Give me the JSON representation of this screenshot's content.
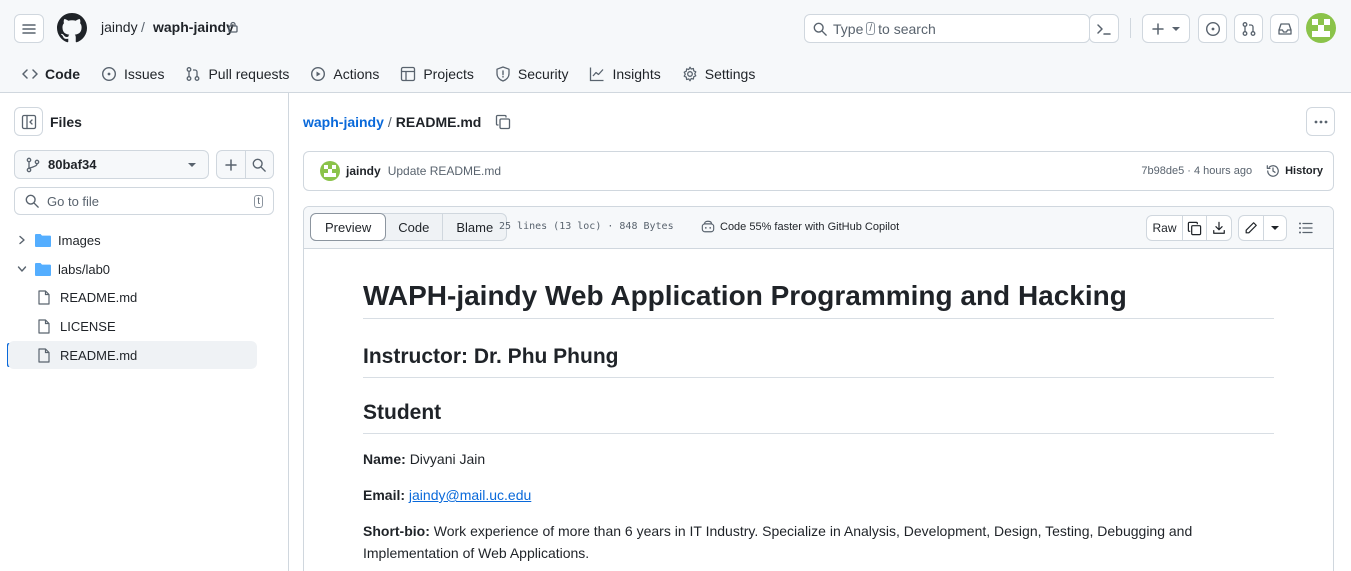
{
  "header": {
    "owner": "jaindy",
    "separator": "/",
    "repo": "waph-jaindy",
    "search_prefix": "Type",
    "search_key": "/",
    "search_suffix": "to search",
    "cmd_glyph": "›_",
    "new_glyph": "+"
  },
  "nav": {
    "tabs": [
      {
        "label": "Code",
        "icon": "code-icon"
      },
      {
        "label": "Issues",
        "icon": "issue-icon"
      },
      {
        "label": "Pull requests",
        "icon": "pull-request-icon"
      },
      {
        "label": "Actions",
        "icon": "play-icon"
      },
      {
        "label": "Projects",
        "icon": "table-icon"
      },
      {
        "label": "Security",
        "icon": "shield-icon"
      },
      {
        "label": "Insights",
        "icon": "graph-icon"
      },
      {
        "label": "Settings",
        "icon": "gear-icon"
      }
    ]
  },
  "sidebar": {
    "title": "Files",
    "branch": "80baf34",
    "goto_placeholder": "Go to file",
    "goto_key": "t",
    "tree": [
      {
        "label": "Images",
        "type": "folder",
        "expanded": false
      },
      {
        "label": "labs/lab0",
        "type": "folder",
        "expanded": true
      },
      {
        "label": "README.md",
        "type": "file"
      },
      {
        "label": "LICENSE",
        "type": "file"
      },
      {
        "label": "README.md",
        "type": "file",
        "selected": true
      }
    ]
  },
  "file": {
    "repo_link": "waph-jaindy",
    "separator": "/",
    "name": "README.md"
  },
  "commit": {
    "author": "jaindy",
    "message": "Update README.md",
    "meta": "7b98de5 · 4 hours ago",
    "history_label": "History"
  },
  "viewer": {
    "tabs": [
      "Preview",
      "Code",
      "Blame"
    ],
    "stats": "25 lines (13 loc) · 848 Bytes",
    "copilot": "Code 55% faster with GitHub Copilot",
    "raw_label": "Raw"
  },
  "readme": {
    "h1": "WAPH-jaindy Web Application Programming and Hacking",
    "instructor": "Instructor: Dr. Phu Phung",
    "student_heading": "Student",
    "name_label": "Name:",
    "name_value": "Divyani Jain",
    "email_label": "Email:",
    "email_value": "jaindy@mail.uc.edu",
    "bio_label": "Short-bio:",
    "bio_line1": "Work experience of more than 6 years in IT Industry. Specialize in Analysis, Development, Design, Testing, Debugging and",
    "bio_line2": "Implementation of Web Applications."
  },
  "colors": {
    "accent": "#0969da",
    "tab_underline": "#fd8c73",
    "folder": "#54aeff",
    "avatar": "#8bc34a"
  }
}
